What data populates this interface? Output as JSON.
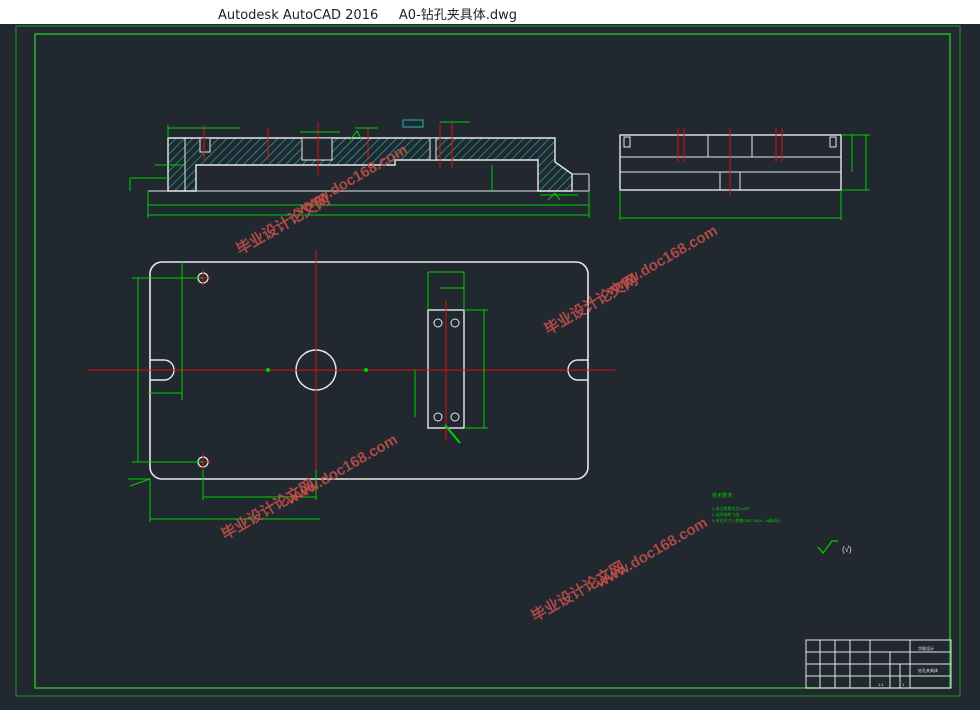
{
  "window": {
    "title": "Autodesk AutoCAD 2016     A0-钻孔夹具体.dwg"
  },
  "drawing": {
    "notes_heading": "技术要求",
    "notes": [
      "1.未注倒角均为1x45°",
      "2.去除毛刺飞边",
      "3.未注尺寸公差按GB/T1804—m级执行"
    ],
    "roughness_label": "(√)",
    "title_block": {
      "drawing_name": "钻孔夹具体",
      "company": "华联设计",
      "scale": "1:1",
      "sheet": "1"
    }
  },
  "colors": {
    "background": "#212830",
    "outline": "#e8e8e8",
    "dimension": "#00d000",
    "centerline": "#e01010",
    "hatch": "#1fb8b0",
    "watermark": "#c8504a"
  },
  "watermarks": [
    "毕业设计论文网",
    "www.doc168.com"
  ]
}
